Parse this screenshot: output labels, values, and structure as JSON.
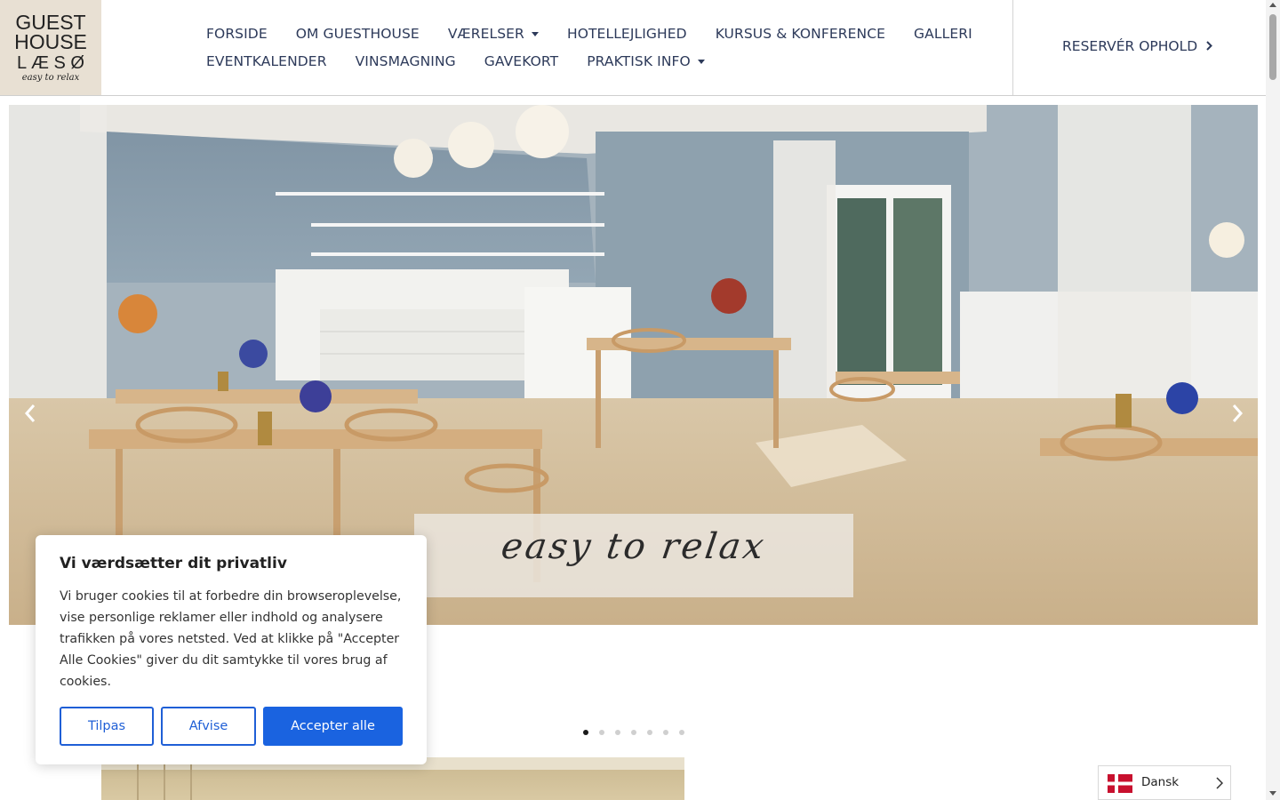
{
  "brand": {
    "logo_line1": "GUEST",
    "logo_line2": "HOUSE",
    "logo_line3": "L Æ S Ø",
    "logo_tagline": "easy to relax"
  },
  "nav": {
    "row1": [
      {
        "label": "FORSIDE",
        "dropdown": false
      },
      {
        "label": "OM GUESTHOUSE",
        "dropdown": false
      },
      {
        "label": "VÆRELSER",
        "dropdown": true
      },
      {
        "label": "HOTELLEJLIGHED",
        "dropdown": false
      },
      {
        "label": "KURSUS & KONFERENCE",
        "dropdown": false
      },
      {
        "label": "GALLERI",
        "dropdown": false
      }
    ],
    "row2": [
      {
        "label": "EVENTKALENDER",
        "dropdown": false
      },
      {
        "label": "VINSMAGNING",
        "dropdown": false
      },
      {
        "label": "GAVEKORT",
        "dropdown": false
      },
      {
        "label": "PRAKTISK INFO",
        "dropdown": true
      }
    ],
    "reserve_label": "RESERVÉR OPHOLD"
  },
  "hero": {
    "tagline": "easy to relax",
    "slide_count": 7,
    "active_slide": 1
  },
  "cookie": {
    "title": "Vi værdsætter dit privatliv",
    "body": "Vi bruger cookies til at forbedre din browseroplevelse, vise personlige reklamer eller indhold og analysere trafikken på vores netsted. Ved at klikke på \"Accepter Alle Cookies\" giver du dit samtykke til vores brug af cookies.",
    "customize_label": "Tilpas",
    "reject_label": "Afvise",
    "accept_label": "Accepter alle"
  },
  "language": {
    "label": "Dansk"
  },
  "colors": {
    "nav_text": "#2d3a5a",
    "accent_blue": "#1a63e0",
    "logo_bg": "#e8e0d3"
  }
}
